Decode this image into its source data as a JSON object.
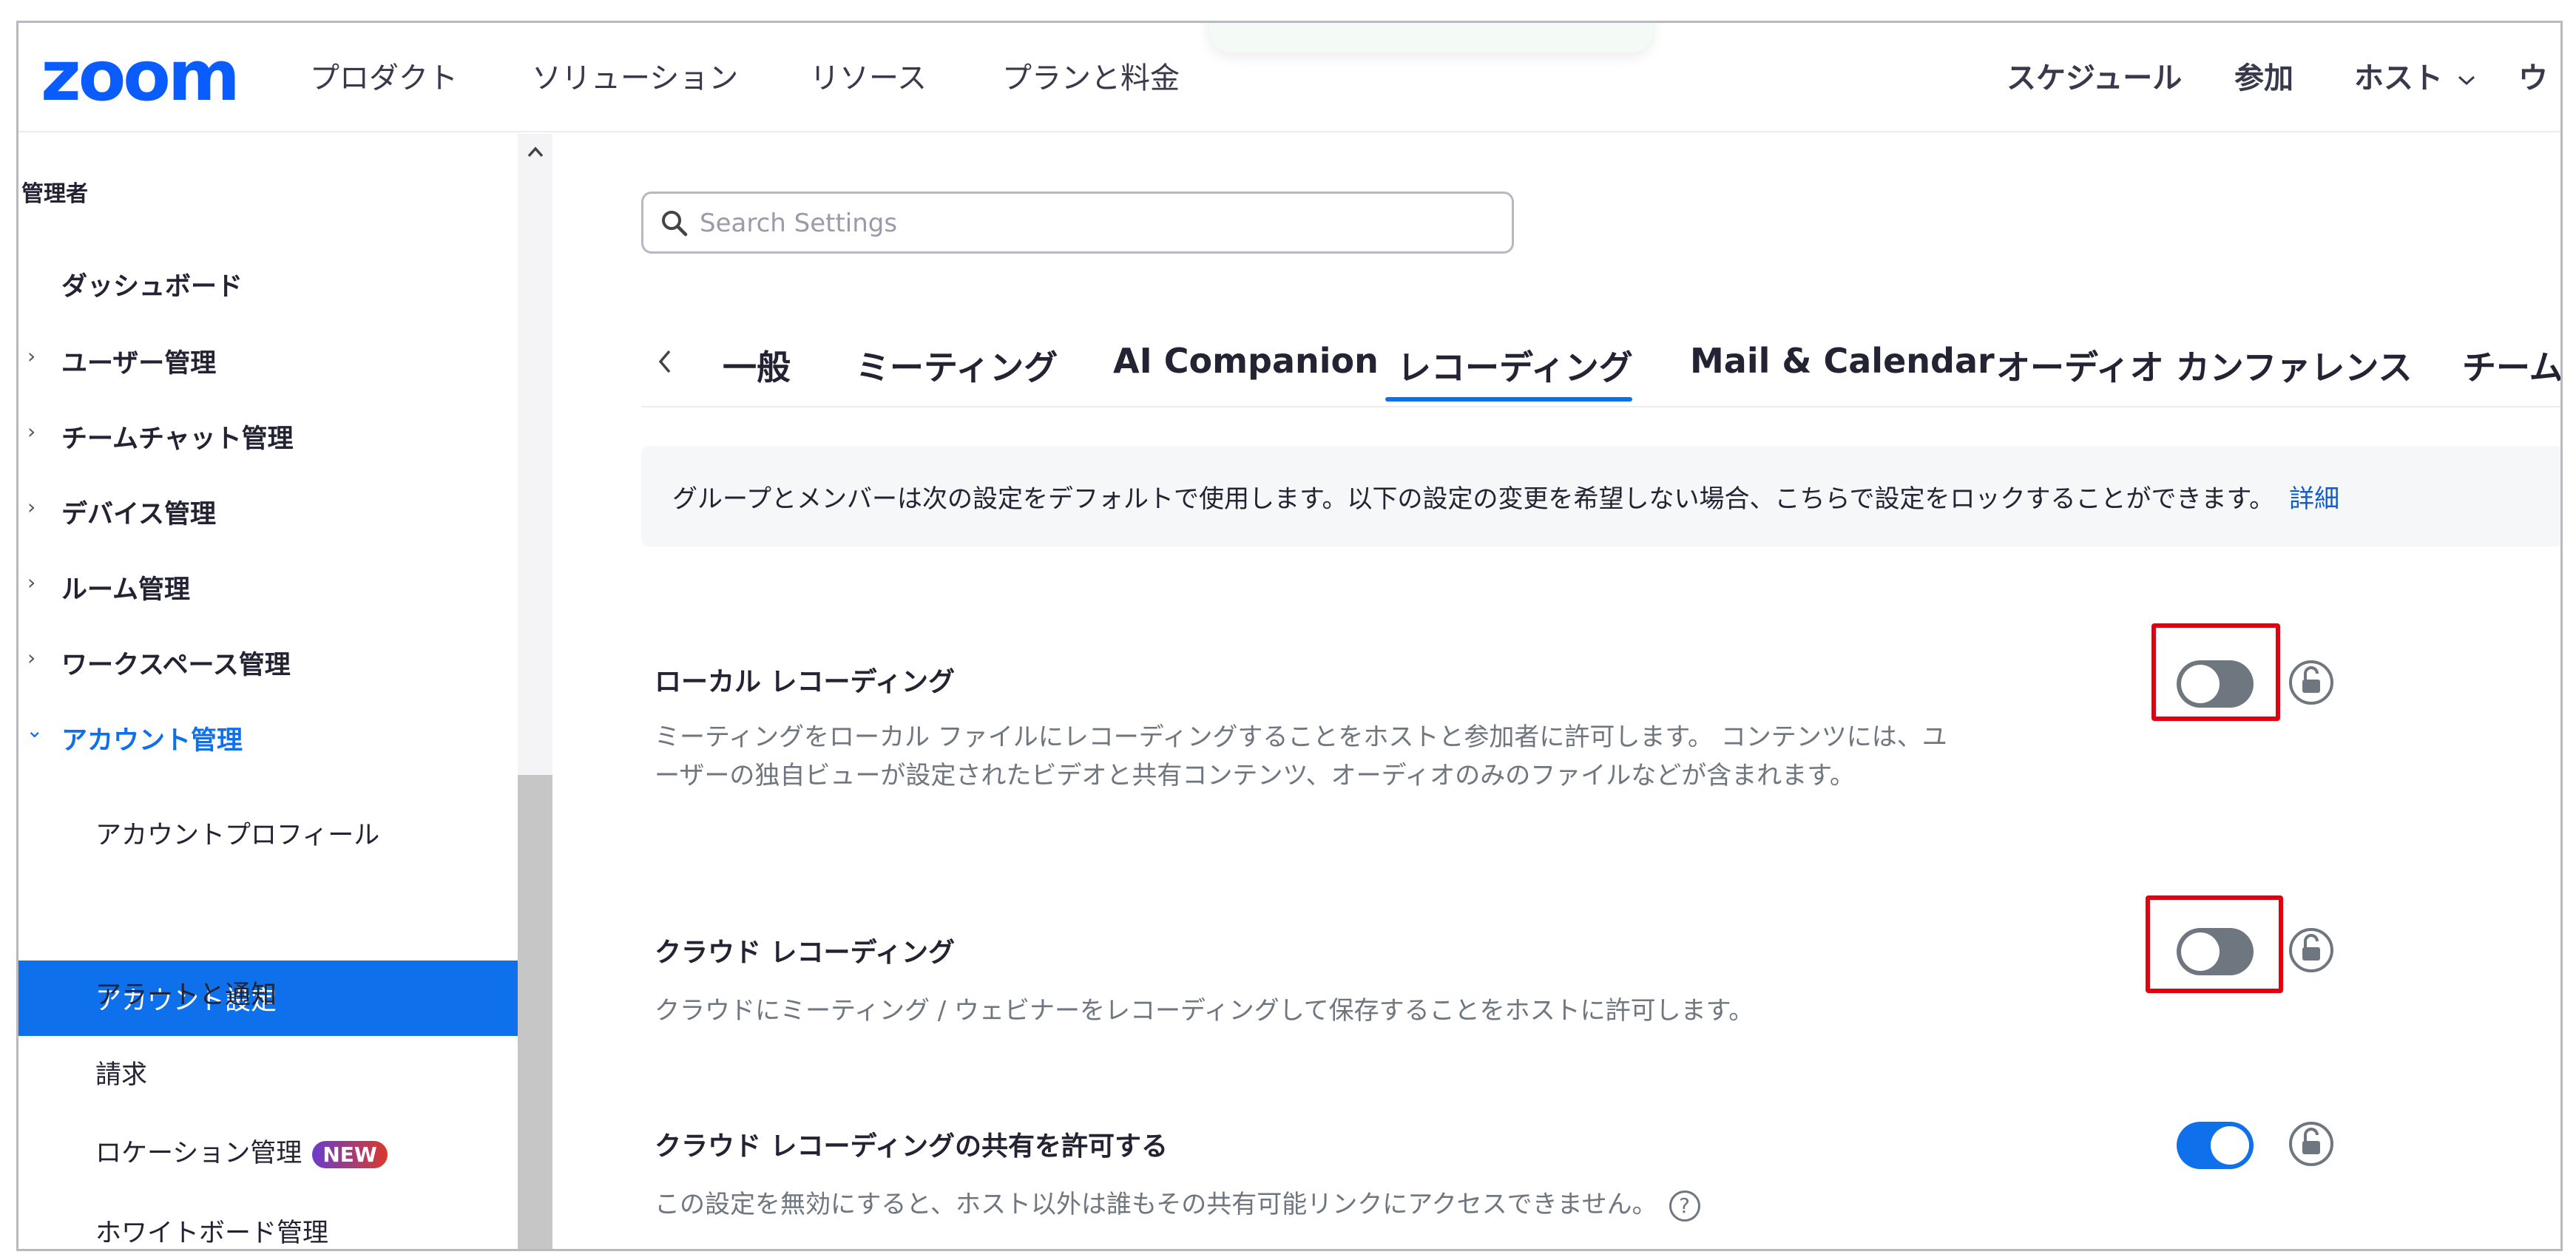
{
  "topnav": {
    "logo": "zoom",
    "items": [
      "プロダクト",
      "ソリューション",
      "リソース",
      "プランと料金"
    ],
    "right_items": [
      "スケジュール",
      "参加",
      "ホスト",
      "ウ"
    ]
  },
  "sidebar": {
    "heading": "管理者",
    "items": [
      {
        "label": "ダッシュボード"
      },
      {
        "label": "ユーザー管理"
      },
      {
        "label": "チームチャット管理"
      },
      {
        "label": "デバイス管理"
      },
      {
        "label": "ルーム管理"
      },
      {
        "label": "ワークスペース管理"
      },
      {
        "label": "アカウント管理"
      }
    ],
    "subitems": [
      {
        "label": "アカウントプロフィール"
      },
      {
        "label": "アカウント設定"
      },
      {
        "label": "アラートと通知"
      },
      {
        "label": "請求"
      },
      {
        "label": "ロケーション管理",
        "badge": "NEW"
      },
      {
        "label": "ホワイトボード管理"
      }
    ]
  },
  "search": {
    "placeholder": "Search Settings",
    "value": ""
  },
  "tabs": [
    "一般",
    "ミーティング",
    "AI Companion",
    "レコーディング",
    "Mail & Calendar",
    "オーディオ カンファレンス",
    "チームチ"
  ],
  "active_tab": "レコーディング",
  "notice": {
    "text": "グループとメンバーは次の設定をデフォルトで使用します。以下の設定の変更を希望しない場合、こちらで設定をロックすることができます。",
    "link": "詳細"
  },
  "settings": [
    {
      "title": "ローカル レコーディング",
      "description": "ミーティングをローカル ファイルにレコーディングすることをホストと参加者に許可します。 コンテンツには、ユーザーの独自ビューが設定されたビデオと共有コンテンツ、オーディオのみのファイルなどが含まれます。",
      "enabled": false
    },
    {
      "title": "クラウド レコーディング",
      "description": "クラウドにミーティング / ウェビナーをレコーディングして保存することをホストに許可します。",
      "enabled": false
    },
    {
      "title": "クラウド レコーディングの共有を許可する",
      "description": "この設定を無効にすると、ホスト以外は誰もその共有可能リンクにアクセスできません。",
      "enabled": true
    }
  ],
  "colors": {
    "brand": "#0b5cff",
    "accent": "#0e71eb",
    "highlight": "#e3000f"
  },
  "icons": {
    "search": "search-icon",
    "lock": "unlock-icon",
    "help": "question-icon",
    "chevron": "chevron-icon"
  }
}
